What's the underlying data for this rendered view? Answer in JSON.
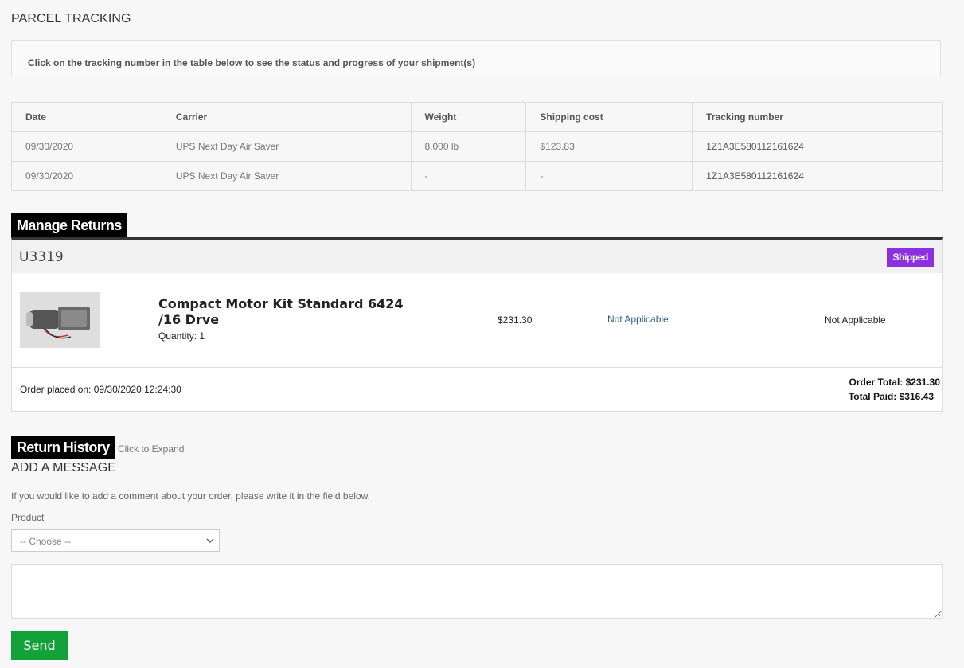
{
  "parcel_tracking": {
    "title": "PARCEL TRACKING",
    "info": "Click on the tracking number in the table below to see the status and progress of your shipment(s)"
  },
  "tracking_table": {
    "headers": [
      "Date",
      "Carrier",
      "Weight",
      "Shipping cost",
      "Tracking number"
    ],
    "rows": [
      {
        "date": "09/30/2020",
        "carrier": "UPS Next Day Air Saver",
        "weight": "8.000 lb",
        "cost": "$123.83",
        "tracking": "1Z1A3E580112161624"
      },
      {
        "date": "09/30/2020",
        "carrier": "UPS Next Day Air Saver",
        "weight": "-",
        "cost": "-",
        "tracking": "1Z1A3E580112161624"
      }
    ]
  },
  "manage_returns": {
    "title": "Manage Returns",
    "order_id": "U3319",
    "status": "Shipped",
    "status_color": "#8b2fe0",
    "product": {
      "image_icon": "motor-kit-image",
      "name": "Compact Motor Kit Standard 6424 /16 Drve",
      "quantity": "Quantity: 1",
      "price": "$231.30",
      "return_link": "Not Applicable",
      "return_status": "Not Applicable"
    },
    "order_placed": "Order placed on: 09/30/2020 12:24:30",
    "order_total": "Order Total: $231.30",
    "total_paid": "Total Paid: $316.43"
  },
  "return_history": {
    "title": "Return History",
    "expand": "Click to Expand"
  },
  "add_message": {
    "title": "ADD A MESSAGE",
    "help": "If you would like to add a comment about your order, please write it in the field below.",
    "product_label": "Product",
    "product_select": "-- Choose --",
    "send_label": "Send",
    "send_color": "#13a23a"
  }
}
